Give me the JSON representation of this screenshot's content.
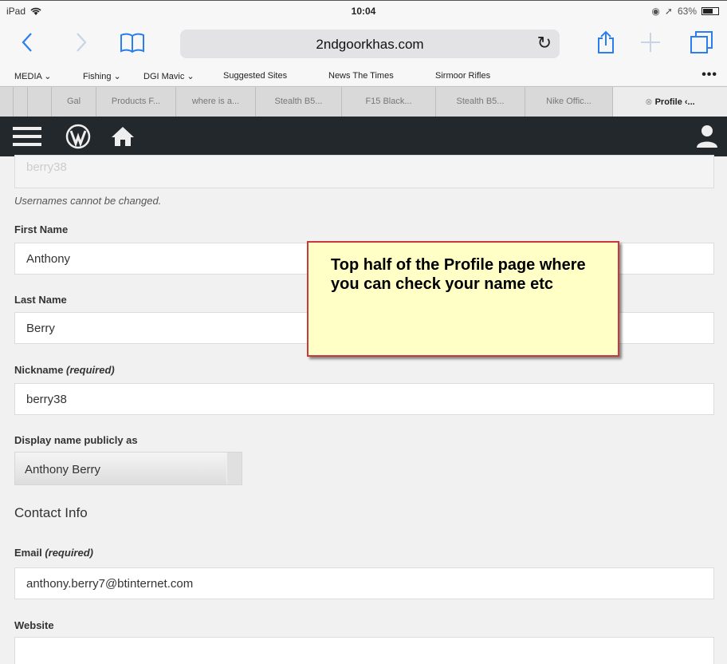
{
  "status_bar": {
    "device": "iPad",
    "time": "10:04",
    "battery": "63%"
  },
  "browser": {
    "url": "2ndgoorkhas.com",
    "bookmarks": [
      "MEDIA ⌄",
      "Fishing ⌄",
      "DGI Mavic ⌄",
      "Suggested Sites",
      "News The Times",
      "Sirmoor Rifles"
    ],
    "more": "•••",
    "tabs": [
      "Gal",
      "Products F...",
      "where is a...",
      "Stealth B5...",
      "F15 Black...",
      "Stealth B5...",
      "Nike Offic...",
      "Profile ‹..."
    ]
  },
  "form": {
    "username_value": "berry38",
    "username_desc": "Usernames cannot be changed.",
    "first_name_label": "First Name",
    "first_name_value": "Anthony",
    "last_name_label": "Last Name",
    "last_name_value": "Berry",
    "nickname_label": "Nickname",
    "required": "(required)",
    "nickname_value": "berry38",
    "display_name_label": "Display name publicly as",
    "display_name_value": "Anthony Berry",
    "contact_heading": "Contact Info",
    "email_label": "Email",
    "email_value": "anthony.berry7@btinternet.com",
    "website_label": "Website",
    "website_value": ""
  },
  "callout": {
    "text": "Top half of the Profile page where you can check your name etc"
  }
}
